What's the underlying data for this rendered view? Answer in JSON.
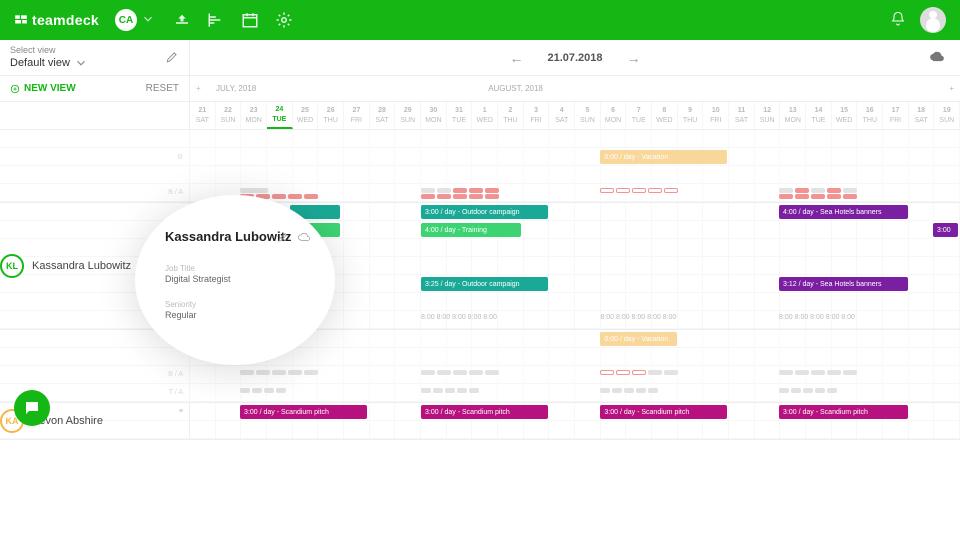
{
  "app": {
    "name": "teamdeck",
    "user_badge": "CA"
  },
  "subbar": {
    "select_view_label": "Select view",
    "view_name": "Default view"
  },
  "date_nav": {
    "date": "21.07.2018"
  },
  "newview": {
    "label": "NEW VIEW",
    "reset": "RESET"
  },
  "months": {
    "m1": "JULY, 2018",
    "m2": "AUGUST, 2018"
  },
  "days": [
    {
      "num": "21",
      "dow": "SAT"
    },
    {
      "num": "22",
      "dow": "SUN"
    },
    {
      "num": "23",
      "dow": "MON"
    },
    {
      "num": "24",
      "dow": "TUE",
      "today": true
    },
    {
      "num": "25",
      "dow": "WED"
    },
    {
      "num": "26",
      "dow": "THU"
    },
    {
      "num": "27",
      "dow": "FRI"
    },
    {
      "num": "28",
      "dow": "SAT"
    },
    {
      "num": "29",
      "dow": "SUN"
    },
    {
      "num": "30",
      "dow": "MON"
    },
    {
      "num": "31",
      "dow": "TUE"
    },
    {
      "num": "1",
      "dow": "WED"
    },
    {
      "num": "2",
      "dow": "THU"
    },
    {
      "num": "3",
      "dow": "FRI"
    },
    {
      "num": "4",
      "dow": "SAT"
    },
    {
      "num": "5",
      "dow": "SUN"
    },
    {
      "num": "6",
      "dow": "MON"
    },
    {
      "num": "7",
      "dow": "TUE"
    },
    {
      "num": "8",
      "dow": "WED"
    },
    {
      "num": "9",
      "dow": "THU"
    },
    {
      "num": "10",
      "dow": "FRI"
    },
    {
      "num": "11",
      "dow": "SAT"
    },
    {
      "num": "12",
      "dow": "SUN"
    },
    {
      "num": "13",
      "dow": "MON"
    },
    {
      "num": "14",
      "dow": "TUE"
    },
    {
      "num": "15",
      "dow": "WED"
    },
    {
      "num": "16",
      "dow": "THU"
    },
    {
      "num": "17",
      "dow": "FRI"
    },
    {
      "num": "18",
      "dow": "SAT"
    },
    {
      "num": "19",
      "dow": "SUN"
    }
  ],
  "rowlabels": {
    "ba": "B / A",
    "ta": "T / A"
  },
  "people": {
    "p1": {
      "initials": "KL",
      "name": "Kassandra Lubowitz"
    },
    "p2": {
      "initials": "KA",
      "name": "Kevon Abshire"
    }
  },
  "popup": {
    "name": "Kassandra Lubowitz",
    "job_label": "Job Title",
    "job_value": "Digital Strategist",
    "seniority_label": "Seniority",
    "seniority_value": "Regular"
  },
  "events": {
    "vacation1": "0:00 / day - Vacation",
    "vacation2": "0:00 / day - Vacation",
    "outdoor1": "3:00 / day - Outdoor campaign",
    "outdoor2": "3:25 / day - Outdoor campaign",
    "training": "4:00 / day - Training",
    "seahotels1": "4:00 / day - Sea Hotels banners",
    "seahotels2": "3:12 / day - Sea Hotels banners",
    "seahotels_short": "3:00",
    "scandium": "3:00 / day - Scandium pitch",
    "hoursA": "8:00  8:00  8:00  8:00",
    "hoursB": "8:00  8:00  8:00  8:00  8:00",
    "hoursC": "8:00  8:00  8:00"
  }
}
